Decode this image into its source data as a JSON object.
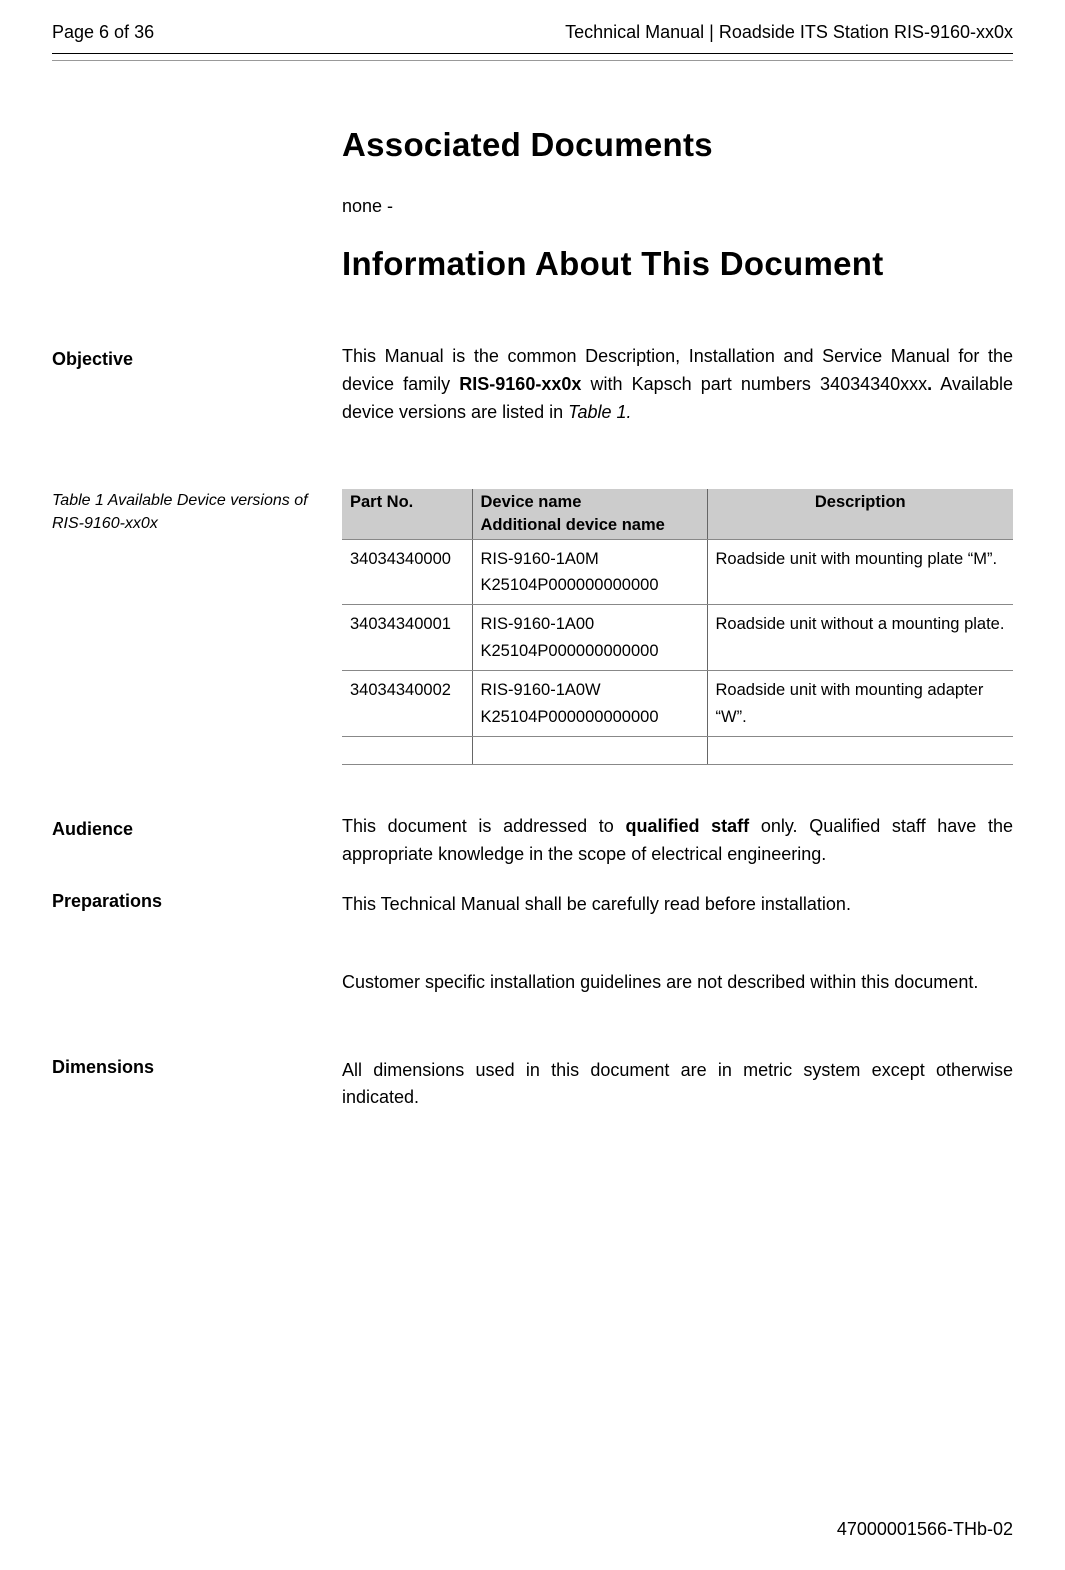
{
  "header": {
    "page": "Page 6 of 36",
    "title": "Technical Manual | Roadside ITS Station RIS-9160-xx0x"
  },
  "headings": {
    "assoc": "Associated Documents",
    "info": "Information About This Document"
  },
  "assoc_text": "none -",
  "labels": {
    "objective": "Objective",
    "audience": "Audience",
    "preparations": "Preparations",
    "dimensions": "Dimensions",
    "table_caption": "Table 1 Available Device versions of RIS-9160-xx0x"
  },
  "objective": {
    "pre": "This Manual is the common Description, Installation and Service Manual for the device family ",
    "bold1": "RIS-9160-xx0x",
    "mid": " with Kapsch part numbers 34034340xxx",
    "bold2": ".",
    "post": " Available device versions are listed in ",
    "italic": "Table 1.",
    "end": ""
  },
  "table": {
    "h1": "Part No.",
    "h2a": "Device name",
    "h2b": "Additional device name",
    "h3": "Description",
    "rows": [
      {
        "part": "34034340000",
        "dev": "RIS-9160-1A0M",
        "add": "K25104P000000000000",
        "desc": "Roadside unit with mounting plate “M”."
      },
      {
        "part": "34034340001",
        "dev": "RIS-9160-1A00",
        "add": "K25104P000000000000",
        "desc": "Roadside unit without a mounting plate."
      },
      {
        "part": "34034340002",
        "dev": "RIS-9160-1A0W",
        "add": "K25104P000000000000",
        "desc": "Roadside unit with mounting adapter “W”."
      }
    ]
  },
  "audience": {
    "pre": "This document is addressed to ",
    "bold": "qualified staff",
    "post": " only. Qualified staff have the appropriate knowledge in the scope of electrical engineering."
  },
  "preparations": {
    "p1": "This Technical Manual shall be carefully read before installation.",
    "p2": "Customer specific installation guidelines are not described within this document."
  },
  "dimensions": "All dimensions used in this document are in metric system except otherwise indicated.",
  "footer": "47000001566-THb-02"
}
